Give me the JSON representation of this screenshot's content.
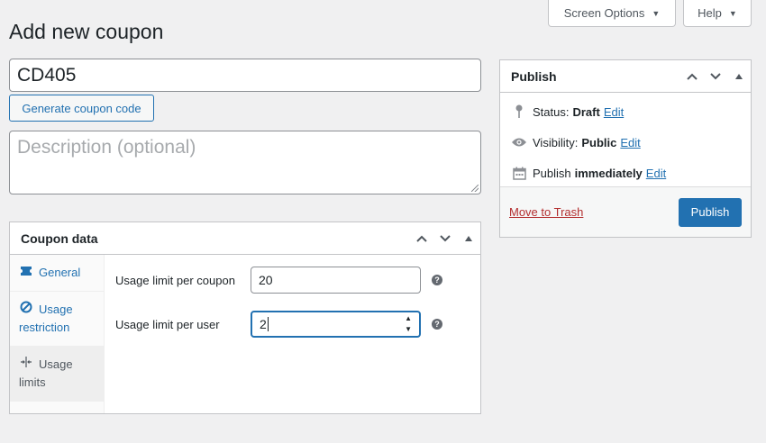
{
  "screen_meta": {
    "screen_options_label": "Screen Options",
    "help_label": "Help"
  },
  "page": {
    "title": "Add new coupon"
  },
  "coupon": {
    "code_value": "CD405",
    "generate_label": "Generate coupon code",
    "description_placeholder": "Description (optional)"
  },
  "coupon_data": {
    "title": "Coupon data",
    "tabs": [
      {
        "label": "General",
        "icon": "ticket-icon"
      },
      {
        "label": "Usage restriction",
        "icon": "block-icon"
      },
      {
        "label": "Usage limits",
        "icon": "limits-icon"
      }
    ],
    "active_tab": "Usage limits",
    "fields": {
      "per_coupon_label": "Usage limit per coupon",
      "per_coupon_value": "20",
      "per_user_label": "Usage limit per user",
      "per_user_value": "2"
    }
  },
  "publish": {
    "title": "Publish",
    "status_label": "Status:",
    "status_value": "Draft",
    "visibility_label": "Visibility:",
    "visibility_value": "Public",
    "publish_label": "Publish",
    "publish_value": "immediately",
    "edit_label": "Edit",
    "trash_label": "Move to Trash",
    "publish_button": "Publish"
  },
  "colors": {
    "accent": "#2271b1",
    "danger": "#b32d2e",
    "background": "#f0f0f1"
  }
}
